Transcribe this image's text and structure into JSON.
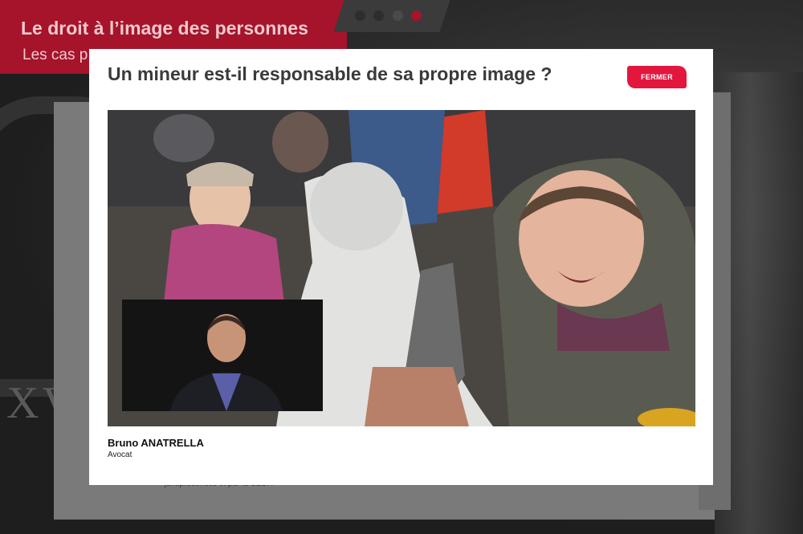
{
  "header": {
    "title": "Le droit à l’image des personnes",
    "subtitle": "Les cas p"
  },
  "pager": {
    "dots": [
      {
        "color": "#2d2d2d"
      },
      {
        "color": "#2d2d2d"
      },
      {
        "color": "#4a4a4a"
      },
      {
        "color": "#a5142a",
        "active": true
      }
    ]
  },
  "background_card": {
    "fragment": "jurisprudences et par la CEDH"
  },
  "modal": {
    "title": "Un mineur est-il responsable de sa propre image ?",
    "close_label": "FERMER",
    "caption_name": "Bruno ANATRELLA",
    "caption_role": "Avocat"
  },
  "colors": {
    "accent": "#e3173e",
    "header_band": "#a5142a"
  }
}
